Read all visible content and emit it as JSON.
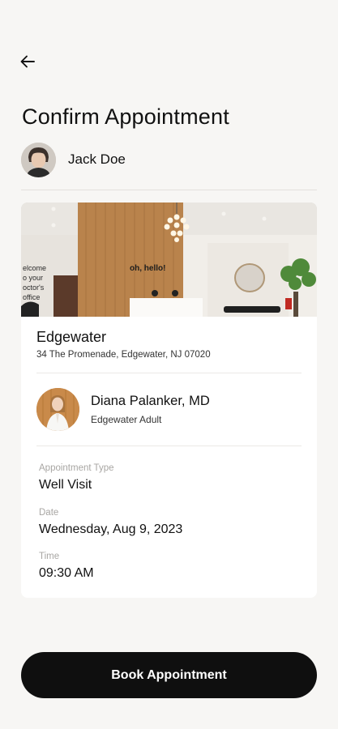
{
  "header": {
    "back_icon": "arrow-left-icon",
    "title": "Confirm Appointment"
  },
  "patient": {
    "name": "Jack Doe"
  },
  "location": {
    "photo_sign_text": "oh, hello!",
    "wall_text": "elcome\no your\noctor's\noffice",
    "name": "Edgewater",
    "address": "34 The Promenade, Edgewater, NJ 07020"
  },
  "provider": {
    "name": "Diana Palanker, MD",
    "department": "Edgewater Adult"
  },
  "details": {
    "type_label": "Appointment Type",
    "type_value": "Well Visit",
    "date_label": "Date",
    "date_value": "Wednesday, Aug 9, 2023",
    "time_label": "Time",
    "time_value": "09:30 AM"
  },
  "actions": {
    "book_label": "Book Appointment"
  },
  "colors": {
    "background": "#f7f6f4",
    "button": "#0f0f0f",
    "muted_label": "#a8a6a3"
  }
}
